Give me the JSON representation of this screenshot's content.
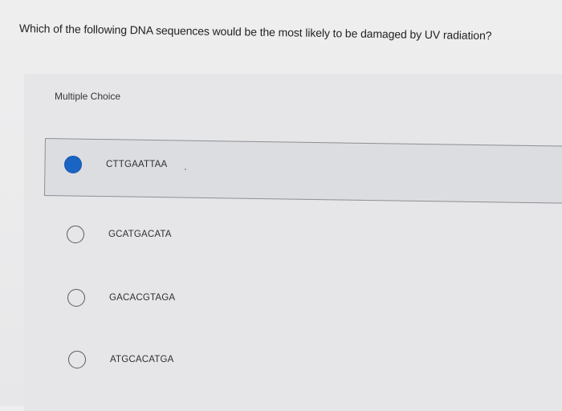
{
  "question": {
    "text": "Which of the following DNA sequences would be the most likely to be damaged by UV radiation?"
  },
  "section": {
    "label": "Multiple Choice"
  },
  "choices": [
    {
      "label": "CTTGAATTAA",
      "selected": true
    },
    {
      "label": "GCATGACATA",
      "selected": false
    },
    {
      "label": "GACACGTAGA",
      "selected": false
    },
    {
      "label": "ATGCACATGA",
      "selected": false
    }
  ],
  "colors": {
    "selected_radio": "#1a64c4",
    "selected_row_bg": "#dcdde0"
  }
}
